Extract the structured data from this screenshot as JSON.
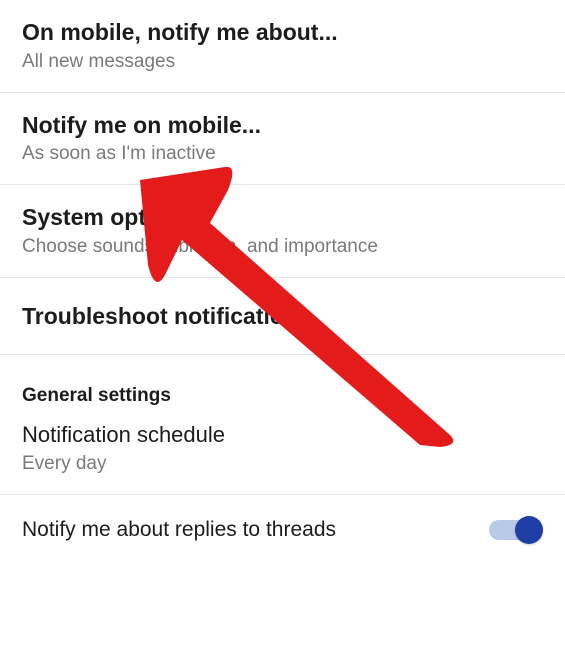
{
  "items": [
    {
      "title": "On mobile, notify me about...",
      "subtitle": "All new messages"
    },
    {
      "title": "Notify me on mobile...",
      "subtitle": "As soon as I'm inactive"
    },
    {
      "title": "System options",
      "subtitle": "Choose sounds, vibration, and importance"
    },
    {
      "title": "Troubleshoot notifications"
    }
  ],
  "section_header": "General settings",
  "schedule": {
    "title": "Notification schedule",
    "subtitle": "Every day"
  },
  "threads": {
    "label": "Notify me about replies to threads",
    "enabled": true
  },
  "annotation": {
    "color": "#e31b1b",
    "target": "notify-me-on-mobile"
  }
}
